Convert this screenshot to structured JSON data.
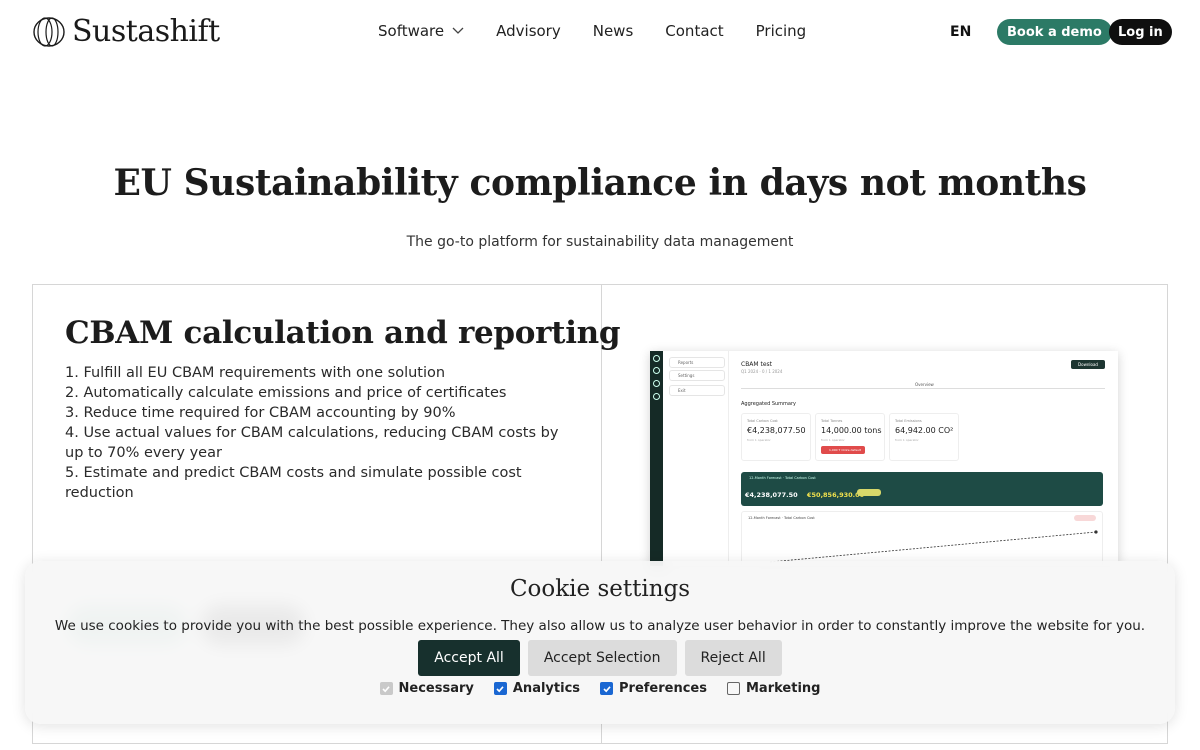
{
  "brand": {
    "name": "Sustashift"
  },
  "nav": {
    "items": [
      {
        "label": "Software",
        "has_dropdown": true
      },
      {
        "label": "Advisory"
      },
      {
        "label": "News"
      },
      {
        "label": "Contact"
      },
      {
        "label": "Pricing"
      }
    ],
    "language": "EN",
    "demo_button": "Book a demo",
    "login_button": "Log in"
  },
  "hero": {
    "title": "EU Sustainability compliance in days not months",
    "subtitle": "The go-to platform for sustainability data management"
  },
  "feature": {
    "title": "CBAM calculation and reporting",
    "points": [
      "1. Fulfill all EU CBAM requirements with one solution",
      "2. Automatically calculate emissions and price of certificates",
      "3. Reduce time required for CBAM accounting by 90%",
      "4. Use actual values for CBAM calculations, reducing CBAM costs by up to 70% every year",
      "5. Estimate and predict CBAM costs and simulate possible cost reduction"
    ]
  },
  "dashboard": {
    "sidebar": [
      "Reports",
      "Settings",
      "Exit"
    ],
    "title": "CBAM test",
    "subtitle": "Q1 2024 · 0 / 1 2024",
    "download": "Download",
    "tab": "Overview",
    "section": "Aggregated Summary",
    "kpis": [
      {
        "label": "Total Carbon Cost",
        "value": "€4,238,077.50",
        "note": "from 1 operator"
      },
      {
        "label": "Total Tonnes",
        "value": "14,000.00 tons",
        "note": "from 1 operator",
        "badge": "1,000 T CO2e default"
      },
      {
        "label": "Total Emissions",
        "value": "64,942.00 CO²",
        "note": "from 1 operator"
      }
    ],
    "forecast": {
      "title": "12-Month Forecast · Total Carbon Cost",
      "current": "€4,238,077.50",
      "projected": "€50,856,930.00"
    },
    "chart_title": "12-Month Forecast · Total Carbon Cost"
  },
  "cookie": {
    "title": "Cookie settings",
    "text": "We use cookies to provide you with the best possible experience. They also allow us to analyze user behavior in order to constantly improve the website for you.",
    "buttons": {
      "accept_all": "Accept All",
      "accept_selection": "Accept Selection",
      "reject_all": "Reject All"
    },
    "options": [
      {
        "label": "Necessary",
        "checked": true,
        "disabled": true
      },
      {
        "label": "Analytics",
        "checked": true
      },
      {
        "label": "Preferences",
        "checked": true
      },
      {
        "label": "Marketing",
        "checked": false
      }
    ]
  },
  "colors": {
    "accent_green": "#2c7a66",
    "dark": "#17302d",
    "check_blue": "#1a67d2"
  }
}
